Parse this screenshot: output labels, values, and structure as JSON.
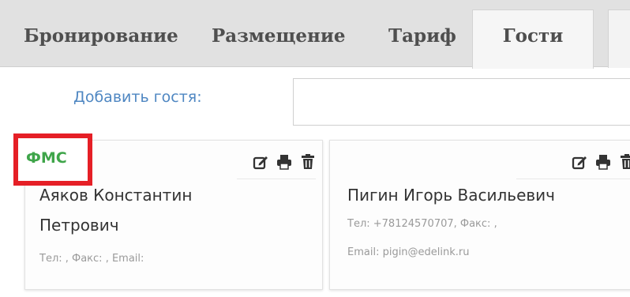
{
  "tabs": [
    {
      "label": "Бронирование"
    },
    {
      "label": "Размещение"
    },
    {
      "label": "Тариф"
    },
    {
      "label": "Гости"
    }
  ],
  "active_tab": "Гости",
  "add_guest": {
    "label": "Добавить гостя:",
    "value": ""
  },
  "fms_label": "ФМС",
  "guests": [
    {
      "name_line1": "Аяков Константин",
      "name_line2": "Петрович",
      "contacts": "Тел: , Факс: , Email:"
    },
    {
      "name_line1": "Пигин Игорь Васильевич",
      "contacts_line1": "Тел: +78124570707, Факс: ,",
      "contacts_line2": "Email: pigin@edelink.ru"
    }
  ],
  "colors": {
    "tab_bar": "#e1e1e1",
    "link_blue": "#4f87c2",
    "fms_green": "#3fa54a",
    "highlight_red": "#e51f26"
  },
  "icons": [
    "edit-icon",
    "print-icon",
    "trash-icon"
  ]
}
